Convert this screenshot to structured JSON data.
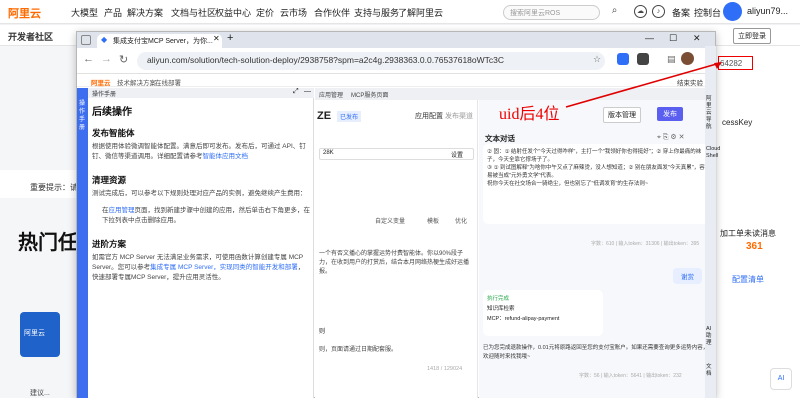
{
  "topnav": {
    "logo": "阿里云",
    "items": [
      "大模型",
      "产品",
      "解决方案",
      "文档与社区",
      "权益中心",
      "定价",
      "云市场",
      "合作伙伴",
      "支持与服务",
      "了解阿里云"
    ],
    "search_placeholder": "搜索阿里云ROS",
    "links": [
      "备案",
      "控制台"
    ],
    "username": "aliyun79..."
  },
  "subbar": {
    "title": "开发者社区",
    "right_label": "立即登录"
  },
  "background": {
    "hint_label": "重要提示：请",
    "hot_title": "热门任",
    "uid_partial": "64282",
    "right_items": [
      {
        "label": "cessKey"
      },
      {
        "label": "加工单",
        "value": ""
      },
      {
        "label": "未读消息",
        "value": "361"
      },
      {
        "label": "配置清单"
      }
    ],
    "cloud_tag": "阿里云",
    "footer_cut": "建议..."
  },
  "browser": {
    "tab_title": "集成支付宝MCP Server，为你...",
    "url": "aliyun.com/solution/tech-solution-deploy/2938758?spm=a2c4g.2938363.0.0.76537618oWTc3C",
    "bookmarks": [
      "阿里云",
      "技术解决方案",
      "在线部署"
    ],
    "bookmark_right": "结束实验"
  },
  "manual": {
    "strip_label": "操作手册",
    "header_label": "操作手册",
    "h1": "后续操作",
    "sec1_title": "发布智能体",
    "sec1_text": "根据使用体验微调智能体配置。满意后即可发布。发布后，可通过 API、钉钉、微信等渠道调用。详细配置请参考",
    "sec1_link": "智能体应用文档",
    "sec2_title": "清理资源",
    "sec2_text": "测试完成后，可以参考以下规则处理对应产品的实例，避免继续产生费用：",
    "sec2_item_pre": "在",
    "sec2_item_link": "应用管理",
    "sec2_item_post": "页面，找到新建步骤中创建的应用，然后单击右下角更多，在下拉列表中点击删除应用。",
    "sec3_title": "进阶方案",
    "sec3_text_pre": "如需官方 MCP Server 无法满足业务需求，可使用函数计算创建专属 MCP Server。您可以参考",
    "sec3_link": "集成专属 MCP Server，实现同类的智能开发和部署",
    "sec3_text_post": "，快速部署专属MCP Server，提升应用灵活性。"
  },
  "appheader": {
    "tabs": [
      "应用管理",
      "MCP服务页面"
    ],
    "center_tabs": [
      "应用配置",
      "发布渠道"
    ]
  },
  "center": {
    "title_cut": "ZE",
    "status_tag": "已发布",
    "model_value": "28K",
    "setting": "设置",
    "var_labels": [
      "自定义变量",
      "模板",
      "优化"
    ],
    "prompt_text": "一个有否文播心的掌握运势付费智能体。你以90%段子力，在收到用户的打赏后，结合本月网络热梗生成好运播报。",
    "rules_head": "则",
    "rules_text": "则，页面请通过日期配套服。",
    "counter": "1418 / 129024"
  },
  "chat": {
    "title": "文本对话",
    "header_buttons": [
      "版本管理",
      "发布"
    ],
    "bot_lines": [
      "② 固：① 结射任发个\"今天过得咋样\"，主打一个\"我领好你也得挺好\"；② 穿上你最痛的袜子，今天全靠它撑场子了。",
      "③ ① 到试图解释\"为啥你中午又点了麻辣烫，没人想知道；② 别在朋友面发\"今天真累\"，容易被当成\"元外勇文学\"代表。",
      "祝你今天在社交场合一骑绝尘，但也别忘了\"低调发育\"的生存法则~"
    ],
    "stats1": "字数：610 | 输入token：31306 | 输出token：395",
    "user_msg": "谢赏",
    "tool_status": "执行完成",
    "tool_search": "知识库检索",
    "tool_mcp": "MCP：refund-alipay-payment",
    "bot_reply": "已为您完成退款操作，0.01元将原路返回至您的支付宝账户。如果还需要查询更多运势内容，欢迎随时来找我哦~",
    "stats2": "字数：56 | 输入token：5641 | 输出token：232"
  },
  "rightbar": {
    "labels": [
      "阿里云导航",
      "Cloud Shell",
      "AI助理",
      "文档"
    ]
  },
  "annotation": {
    "text": "uid后4位",
    "color": "#e00000"
  }
}
